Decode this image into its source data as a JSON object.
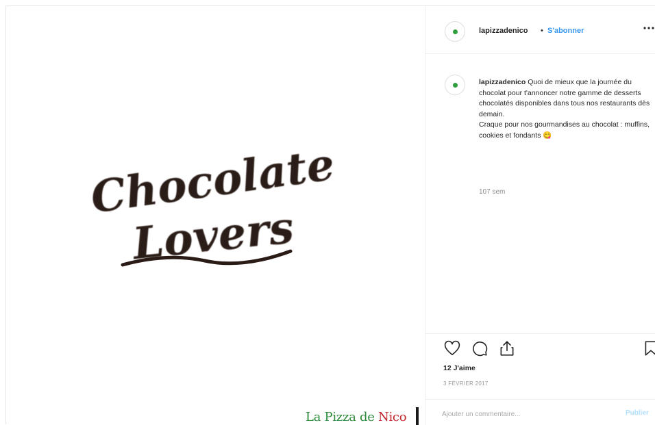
{
  "media": {
    "artwork_line1": "Chocolate",
    "artwork_line2": "Lovers",
    "brand_part1": "La Pizza de ",
    "brand_part2": "Nico"
  },
  "header": {
    "username": "lapizzadenico",
    "separator": "•",
    "follow_label": "S'abonner",
    "more_icon": "more-horizontal-icon"
  },
  "caption": {
    "username": "lapizzadenico",
    "text": "Quoi de mieux que la journée du chocolat pour t'annoncer notre gamme de desserts chocolatés disponibles dans tous nos restaurants dès demain.",
    "text2": "Craque pour nos gourmandises au chocolat : muffins, cookies et fondants 😋",
    "time_ago": "107 sem"
  },
  "actions": {
    "like_icon": "heart-icon",
    "comment_icon": "comment-icon",
    "share_icon": "share-icon",
    "save_icon": "bookmark-icon"
  },
  "likes": "12 J'aime",
  "date": "3 février 2017",
  "comment": {
    "placeholder": "Ajouter un commentaire...",
    "publish_label": "Publier"
  },
  "colors": {
    "link": "#3897f0",
    "publish_disabled": "#b2dffc",
    "brand_green": "#2e8b3a",
    "brand_red": "#c0272d",
    "avatar_dot": "#2e9e3e",
    "artwork_ink": "#2a1b17"
  }
}
